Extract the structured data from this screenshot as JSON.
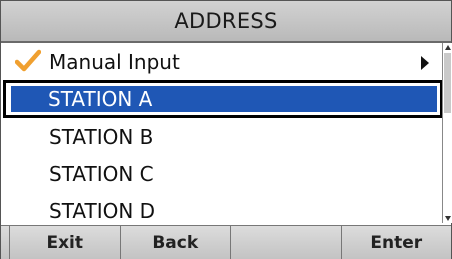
{
  "title": "ADDRESS",
  "items": [
    {
      "label": "Manual Input",
      "checked": true,
      "has_submenu": true
    },
    {
      "label": "STATION A",
      "selected": true
    },
    {
      "label": "STATION B"
    },
    {
      "label": "STATION C"
    },
    {
      "label": "STATION D"
    }
  ],
  "softkeys": [
    "Exit",
    "Back",
    "",
    "Enter"
  ],
  "colors": {
    "selection": "#1f57b5",
    "check": "#f0a030",
    "titlebar": "#c6c6c6"
  },
  "icons": {
    "check": "checkmark-icon",
    "submenu": "triangle-right-icon"
  }
}
